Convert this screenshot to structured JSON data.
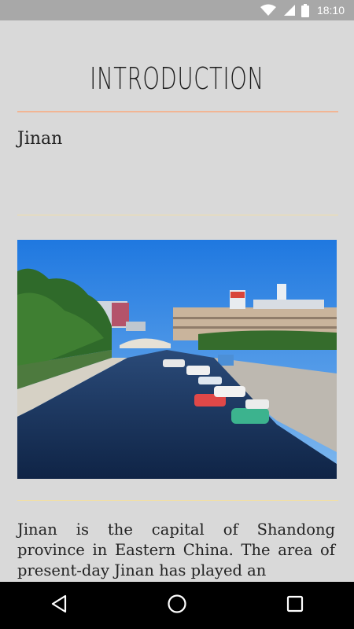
{
  "status_bar": {
    "time": "18:10",
    "icons": [
      "wifi-icon",
      "cell-signal-icon",
      "battery-icon"
    ]
  },
  "page": {
    "title": "INTRODUCTION",
    "city": "Jinan",
    "description": "Jinan is the capital of Shandong province in Eastern China. The area of present-day Jinan has played an"
  },
  "colors": {
    "background": "#d9d9d9",
    "status_bar": "#a8a8a8",
    "title_divider": "#f2b594",
    "section_divider": "#f2dfa6",
    "nav_bar": "#000000"
  },
  "nav_bar": {
    "buttons": [
      "back-icon",
      "home-icon",
      "recents-icon"
    ]
  }
}
